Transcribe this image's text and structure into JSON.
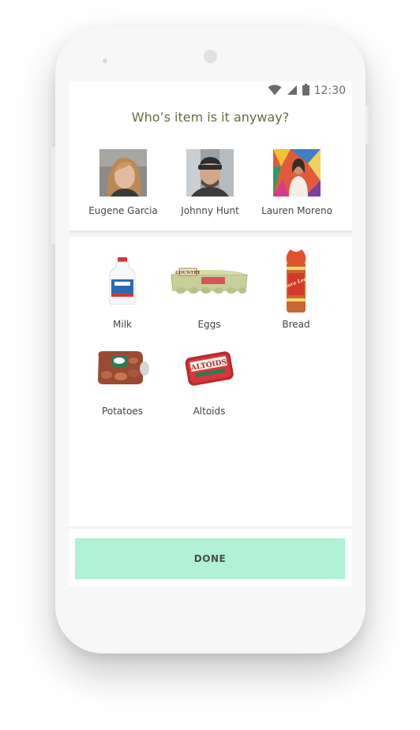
{
  "status_bar": {
    "time": "12:30"
  },
  "header": {
    "title": "Who’s item is it anyway?"
  },
  "people": [
    {
      "name": "Eugene Garcia"
    },
    {
      "name": "Johnny Hunt"
    },
    {
      "name": "Lauren Moreno"
    }
  ],
  "items": [
    {
      "label": "Milk"
    },
    {
      "label": "Eggs"
    },
    {
      "label": "Bread"
    },
    {
      "label": "Potatoes"
    },
    {
      "label": "Altoids"
    }
  ],
  "item_text": {
    "egg_carton_brand": "COUNTRY",
    "bread_brand": "Sara Lee",
    "altoids_brand": "ALTOIDS"
  },
  "footer": {
    "done_label": "DONE"
  },
  "colors": {
    "title": "#6c6a41",
    "done_button": "#b1f2d7",
    "done_text": "#4b4b4b"
  }
}
